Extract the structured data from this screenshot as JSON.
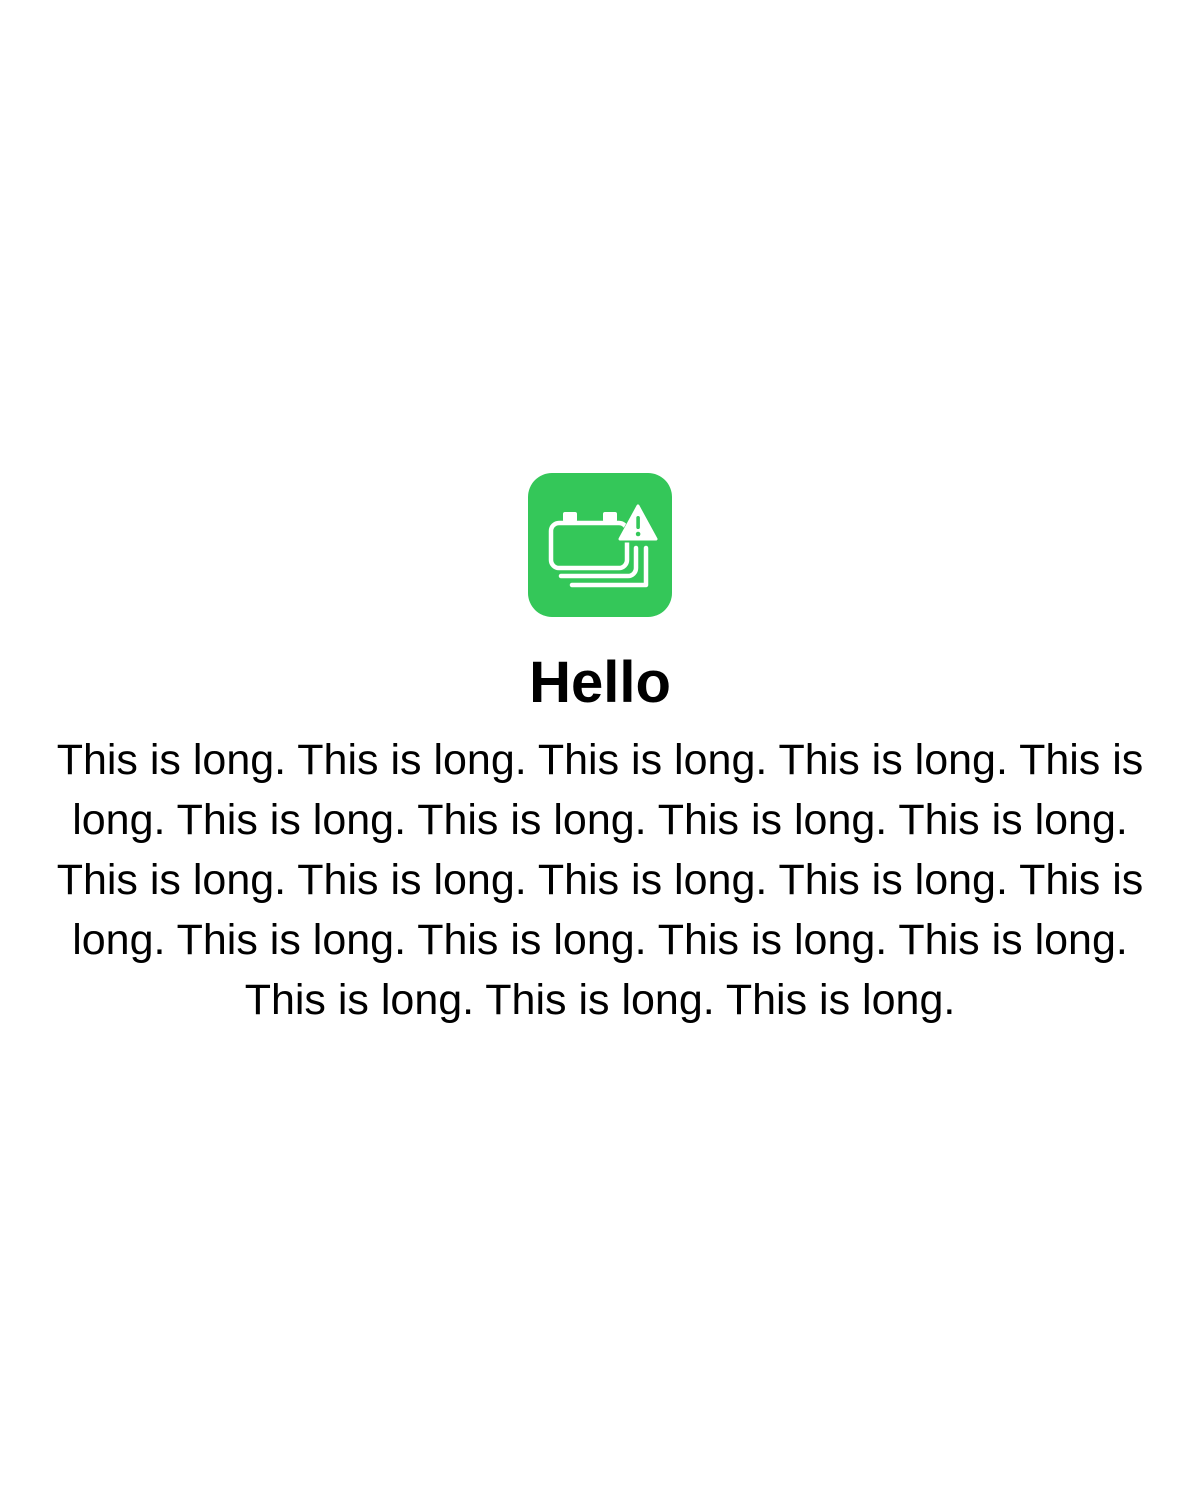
{
  "app_icon": {
    "name": "battery-stack-warning-icon",
    "background": "#34C759",
    "foreground": "#FFFFFF"
  },
  "title": "Hello",
  "body": "This is long. This is long. This is long. This is long. This is long. This is long. This is long. This is long. This is long. This is long. This is long. This is long. This is long. This is long. This is long. This is long. This is long. This is long. This is long. This is long. This is long."
}
